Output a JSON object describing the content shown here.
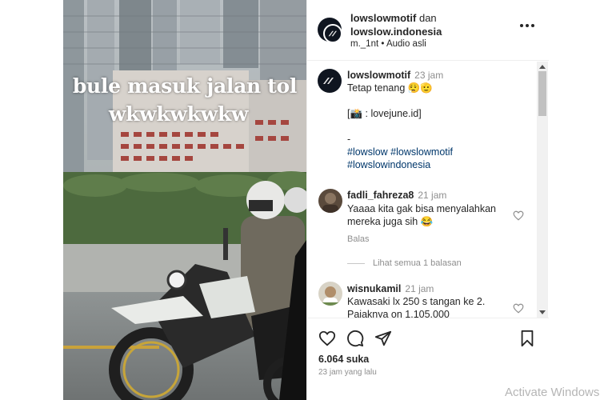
{
  "video": {
    "overlay_line1": "bule masuk jalan tol",
    "overlay_line2": "wkwkwkwkw"
  },
  "header": {
    "author": "lowslowmotif",
    "connector": "dan",
    "coauthor": "lowslow.indonesia",
    "audio": "m._1nt • Audio asli"
  },
  "caption": {
    "username": "lowslowmotif",
    "time": "23 jam",
    "line1": "Tetap tenang 😮‍💨🫡",
    "line2": "[📸 : lovejune.id]",
    "line3": "-",
    "hashtags1": "#lowslow #lowslowmotif",
    "hashtags2": "#lowslowindonesia"
  },
  "comments": [
    {
      "username": "fadli_fahreza8",
      "time": "21 jam",
      "line1": "Yaaaa kita gak bisa menyalahkan",
      "line2": "mereka juga sih 😂",
      "reply_label": "Balas",
      "view_replies": "Lihat semua 1 balasan"
    },
    {
      "username": "wisnukamil",
      "time": "21 jam",
      "line1": "Kawasaki lx 250 s tangan ke 2.",
      "line2": "Pajaknya on 1.105.000"
    }
  ],
  "actions": {
    "likes": "6.064 suka",
    "posted_ago": "23 jam yang lalu"
  },
  "os": {
    "watermark": "Activate Windows"
  },
  "icons": [
    "heart-icon",
    "comment-icon",
    "share-icon",
    "bookmark-icon",
    "more-options-icon"
  ],
  "colors": {
    "text": "#262626",
    "muted": "#8e8e8e",
    "hashtag": "#00376b",
    "avatar_bg": "#0f1520"
  }
}
